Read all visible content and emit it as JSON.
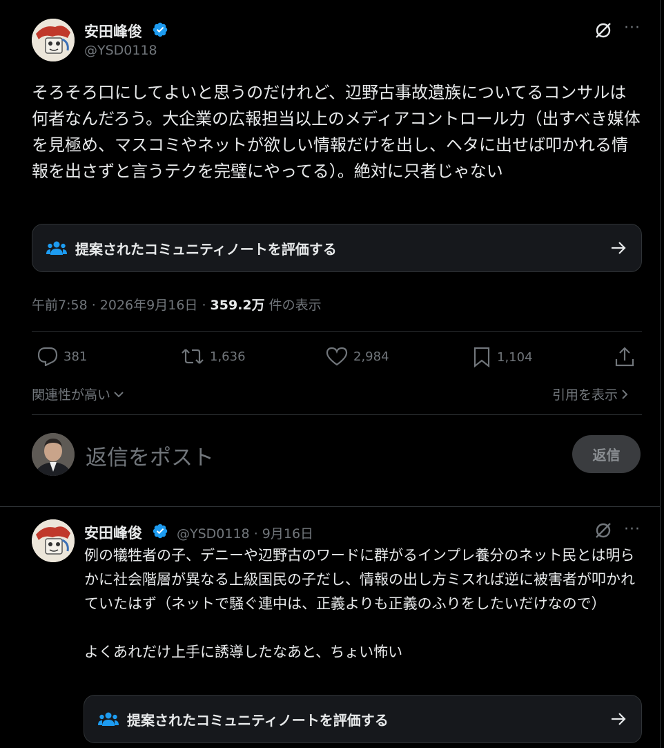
{
  "main_tweet": {
    "author_name": "安田峰俊",
    "author_handle": "@YSD0118",
    "text": "そろそろ口にしてよいと思うのだけれど、辺野古事故遺族についてるコンサルは何者なんだろう。大企業の広報担当以上のメディアコントロール力（出すべき媒体を見極め、マスコミやネットが欲しい情報だけを出し、ヘタに出せば叩かれる情報を出さずと言うテクを完璧にやってる）。絶対に只者じゃない",
    "community_note_label": "提案されたコミュニティノートを評価する",
    "time": "午前7:58 · 2026年9月16日 · ",
    "views_count": "359.2万",
    "views_suffix": " 件の表示",
    "replies": "381",
    "reposts": "1,636",
    "likes": "2,984",
    "bookmarks": "1,104"
  },
  "sort": {
    "relevance_label": "関連性が高い",
    "quotes_label": "引用を表示"
  },
  "reply_box": {
    "placeholder": "返信をポスト",
    "button_label": "返信"
  },
  "reply_tweet": {
    "author_name": "安田峰俊",
    "author_handle": "@YSD0118",
    "date": "· 9月16日",
    "text": "例の犠牲者の子、デニーや辺野古のワードに群がるインプレ養分のネット民とは明らかに社会階層が異なる上級国民の子だし、情報の出し方ミスれば逆に被害者が叩かれていたはず（ネットで騒ぐ連中は、正義よりも正義のふりをしたいだけなので）\n\nよくあれだけ上手に誘導したなあと、ちょい怖い",
    "community_note_label": "提案されたコミュニティノートを評価する"
  },
  "colors": {
    "background": "#000000",
    "verified": "#1d9bf0",
    "muted": "#71767b",
    "border": "#2f3336"
  }
}
